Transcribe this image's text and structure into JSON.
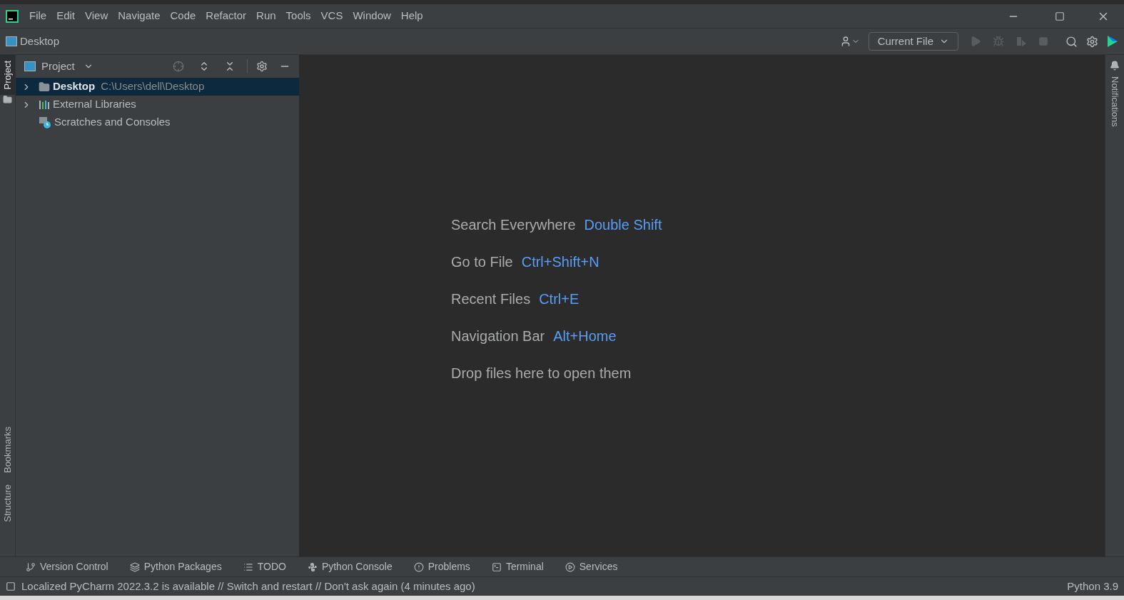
{
  "menu": [
    "File",
    "Edit",
    "View",
    "Navigate",
    "Code",
    "Refactor",
    "Run",
    "Tools",
    "VCS",
    "Window",
    "Help"
  ],
  "nav_bar": {
    "breadcrumb": "Desktop"
  },
  "toolbar": {
    "run_config": "Current File"
  },
  "left_stripe": {
    "top": [
      {
        "label": "Project",
        "selected": true
      }
    ],
    "bottom": [
      {
        "label": "Bookmarks",
        "selected": false
      },
      {
        "label": "Structure",
        "selected": false
      }
    ]
  },
  "right_stripe": [
    {
      "label": "Notifications",
      "selected": false
    }
  ],
  "project_panel": {
    "title": "Project",
    "tree": [
      {
        "kind": "folder",
        "label": "Desktop",
        "path": "C:\\Users\\dell\\Desktop",
        "expandable": true,
        "selected": true
      },
      {
        "kind": "libraries",
        "label": "External Libraries",
        "expandable": true,
        "selected": false
      },
      {
        "kind": "scratches",
        "label": "Scratches and Consoles",
        "expandable": false,
        "selected": false
      }
    ]
  },
  "editor_hints": [
    {
      "label": "Search Everywhere",
      "shortcut": "Double Shift"
    },
    {
      "label": "Go to File",
      "shortcut": "Ctrl+Shift+N"
    },
    {
      "label": "Recent Files",
      "shortcut": "Ctrl+E"
    },
    {
      "label": "Navigation Bar",
      "shortcut": "Alt+Home"
    },
    {
      "label": "Drop files here to open them"
    }
  ],
  "tool_windows": [
    {
      "kind": "vcs",
      "label": "Version Control"
    },
    {
      "kind": "packages",
      "label": "Python Packages"
    },
    {
      "kind": "todo",
      "label": "TODO"
    },
    {
      "kind": "console",
      "label": "Python Console"
    },
    {
      "kind": "problems",
      "label": "Problems"
    },
    {
      "kind": "terminal",
      "label": "Terminal"
    },
    {
      "kind": "services",
      "label": "Services"
    }
  ],
  "status_bar": {
    "message": "Localized PyCharm 2022.3.2 is available // Switch and restart // Don't ask again (4 minutes ago)",
    "interpreter": "Python 3.9"
  }
}
